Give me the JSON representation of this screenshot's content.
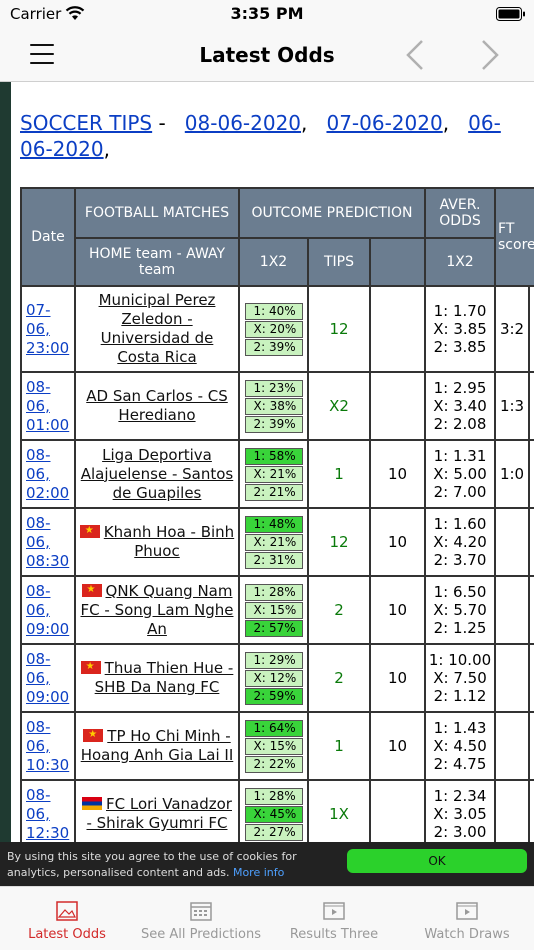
{
  "status": {
    "carrier": "Carrier",
    "time": "3:35 PM"
  },
  "nav": {
    "title": "Latest Odds"
  },
  "header": {
    "title": "SOCCER TIPS",
    "dash": "-",
    "dates": [
      "08-06-2020",
      "07-06-2020",
      "06-06-2020"
    ]
  },
  "table": {
    "headers": {
      "date": "Date",
      "matches": "FOOTBALL MATCHES",
      "outcome": "OUTCOME PREDICTION",
      "aver": "AVER. ODDS",
      "ft": "FT score",
      "home_away": "HOME team - AWAY team",
      "onextwo": "1X2",
      "tips": "TIPS",
      "aver_1x2": "1X2"
    },
    "rows": [
      {
        "date": [
          "07-",
          "06,",
          "23:00"
        ],
        "flag": "",
        "match": "Municipal Perez Zeledon - Universidad de Costa Rica",
        "p1": "1: 40%",
        "px": "X: 20%",
        "p2": "2: 39%",
        "hi": "",
        "tip": "12",
        "extra": "",
        "o1": "1: 1.70",
        "ox": "X: 3.85",
        "o2": "2: 3.85",
        "ft": "3:2",
        "bar": true
      },
      {
        "date": [
          "08-",
          "06,",
          "01:00"
        ],
        "flag": "",
        "match": "AD San Carlos - CS Herediano",
        "p1": "1: 23%",
        "px": "X: 38%",
        "p2": "2: 39%",
        "hi": "",
        "tip": "X2",
        "extra": "",
        "o1": "1: 2.95",
        "ox": "X: 3.40",
        "o2": "2: 2.08",
        "ft": "1:3",
        "bar": true
      },
      {
        "date": [
          "08-",
          "06,",
          "02:00"
        ],
        "flag": "",
        "match": "Liga Deportiva Alajuelense - Santos de Guapiles",
        "p1": "1: 58%",
        "px": "X: 21%",
        "p2": "2: 21%",
        "hi": "1",
        "tip": "1",
        "extra": "10",
        "o1": "1: 1.31",
        "ox": "X: 5.00",
        "o2": "2: 7.00",
        "ft": "1:0",
        "bar": true
      },
      {
        "date": [
          "08-",
          "06,",
          "08:30"
        ],
        "flag": "vn",
        "match": "Khanh Hoa - Binh Phuoc",
        "p1": "1: 48%",
        "px": "X: 21%",
        "p2": "2: 31%",
        "hi": "1",
        "tip": "12",
        "extra": "10",
        "o1": "1: 1.60",
        "ox": "X: 4.20",
        "o2": "2: 3.70",
        "ft": "",
        "bar": false
      },
      {
        "date": [
          "08-",
          "06,",
          "09:00"
        ],
        "flag": "vn",
        "match": "QNK Quang Nam FC - Song Lam Nghe An",
        "p1": "1: 28%",
        "px": "X: 15%",
        "p2": "2: 57%",
        "hi": "2",
        "tip": "2",
        "extra": "10",
        "o1": "1: 6.50",
        "ox": "X: 5.70",
        "o2": "2: 1.25",
        "ft": "",
        "bar": false
      },
      {
        "date": [
          "08-",
          "06,",
          "09:00"
        ],
        "flag": "vn",
        "match": "Thua Thien Hue - SHB Da Nang FC",
        "p1": "1: 29%",
        "px": "X: 12%",
        "p2": "2: 59%",
        "hi": "2",
        "tip": "2",
        "extra": "10",
        "o1": "1: 10.00",
        "ox": "X: 7.50",
        "o2": "2: 1.12",
        "ft": "",
        "bar": false
      },
      {
        "date": [
          "08-",
          "06,",
          "10:30"
        ],
        "flag": "vn",
        "match": "TP Ho Chi Minh - Hoang Anh Gia Lai II",
        "p1": "1: 64%",
        "px": "X: 15%",
        "p2": "2: 22%",
        "hi": "1",
        "tip": "1",
        "extra": "10",
        "o1": "1: 1.43",
        "ox": "X: 4.50",
        "o2": "2: 4.75",
        "ft": "",
        "bar": false
      },
      {
        "date": [
          "08-",
          "06,",
          "12:30"
        ],
        "flag": "am",
        "match": "FC Lori Vanadzor - Shirak Gyumri FC",
        "p1": "1: 28%",
        "px": "X: 45%",
        "p2": "2: 27%",
        "hi": "X",
        "tip": "1X",
        "extra": "",
        "o1": "1: 2.34",
        "ox": "X: 3.05",
        "o2": "2: 3.00",
        "ft": "",
        "bar": false
      }
    ]
  },
  "cookie": {
    "text": "By using this site you agree to the use of cookies for analytics, personalised content and ads.",
    "more": "More info",
    "ok": "OK"
  },
  "tabs": [
    {
      "label": "Latest Odds",
      "icon": "image-icon",
      "active": true
    },
    {
      "label": "See All Predictions",
      "icon": "calendar-icon",
      "active": false
    },
    {
      "label": "Results Three",
      "icon": "video-icon",
      "active": false
    },
    {
      "label": "Watch Draws",
      "icon": "video-icon",
      "active": false
    }
  ],
  "colors": {
    "accent": "#d22a2a",
    "table_header": "#6b7d90",
    "prob_low": "#c9f2bf",
    "prob_high": "#39d43a",
    "link": "#0b3ec4"
  }
}
